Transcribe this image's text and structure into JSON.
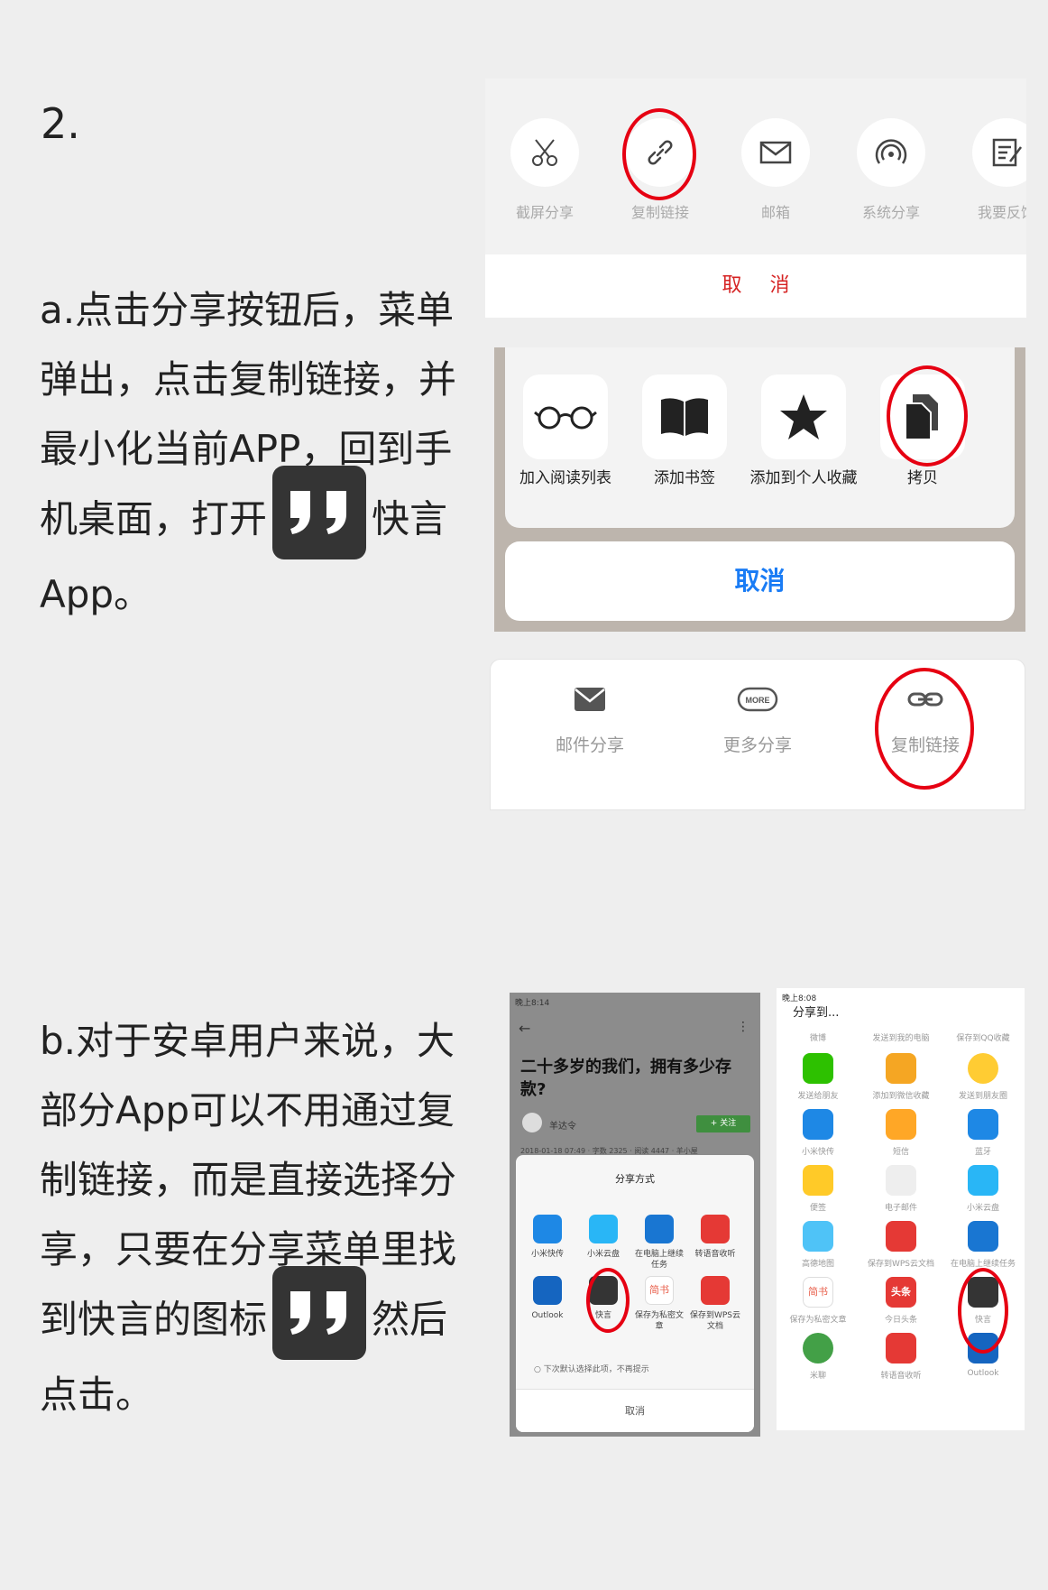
{
  "step": {
    "number": "2."
  },
  "section_a": {
    "text_before": "a.点击分享按钮后，菜单弹出，点击复制链接，并最小化当前APP，回到手机桌面，打开",
    "text_after": "快言App。"
  },
  "section_b": {
    "text_before": "b.对于安卓用户来说，大部分App可以不用通过复制链接，而是直接选择分享，只要在分享菜单里找到快言的图标",
    "text_after": "然后点击。"
  },
  "panel1": {
    "items": [
      "截屏分享",
      "复制链接",
      "邮箱",
      "系统分享",
      "我要反馈"
    ],
    "cancel": "取 消"
  },
  "panel2": {
    "items": [
      "加入阅读列表",
      "添加书签",
      "添加到个人收藏",
      "拷贝"
    ],
    "cancel": "取消"
  },
  "panel3": {
    "items": [
      "邮件分享",
      "更多分享",
      "复制链接"
    ],
    "more_badge": "MORE"
  },
  "panel4": {
    "status_time": "晚上8:14",
    "article_title": "二十多岁的我们，拥有多少存款?",
    "author": "羊达令",
    "follow": "+ 关注",
    "meta": "2018-01-18 07:49 · 字数 2325 · 阅读 4447 · 羊小屋",
    "sheet_title": "分享方式",
    "row1": [
      "小米快传",
      "小米云盘",
      "在电脑上继续任务",
      "转语音收听"
    ],
    "row2": [
      "Outlook",
      "快言",
      "保存为私密文章",
      "保存到WPS云文档"
    ],
    "checkbox": "下次默认选择此项，不再提示",
    "cancel": "取消"
  },
  "panel5": {
    "status_time": "晚上8:08",
    "title": "分享到...",
    "top_labels": [
      "微博",
      "发送到我的电脑",
      "保存到QQ收藏"
    ],
    "rows": [
      [
        "发送给朋友",
        "添加到微信收藏",
        "发送到朋友圈"
      ],
      [
        "小米快传",
        "短信",
        "蓝牙"
      ],
      [
        "便签",
        "电子邮件",
        "小米云盘"
      ],
      [
        "高德地图",
        "保存到WPS云文档",
        "在电脑上继续任务"
      ],
      [
        "保存为私密文章",
        "今日头条",
        "快言"
      ],
      [
        "米聊",
        "转语音收听",
        "Outlook"
      ]
    ],
    "icon_texts": {
      "jianshu": "简书",
      "toutiao": "头条"
    }
  },
  "colors": {
    "highlight": "#e60012",
    "app_icon": "#343434",
    "ios_blue": "#1a7cf5"
  }
}
